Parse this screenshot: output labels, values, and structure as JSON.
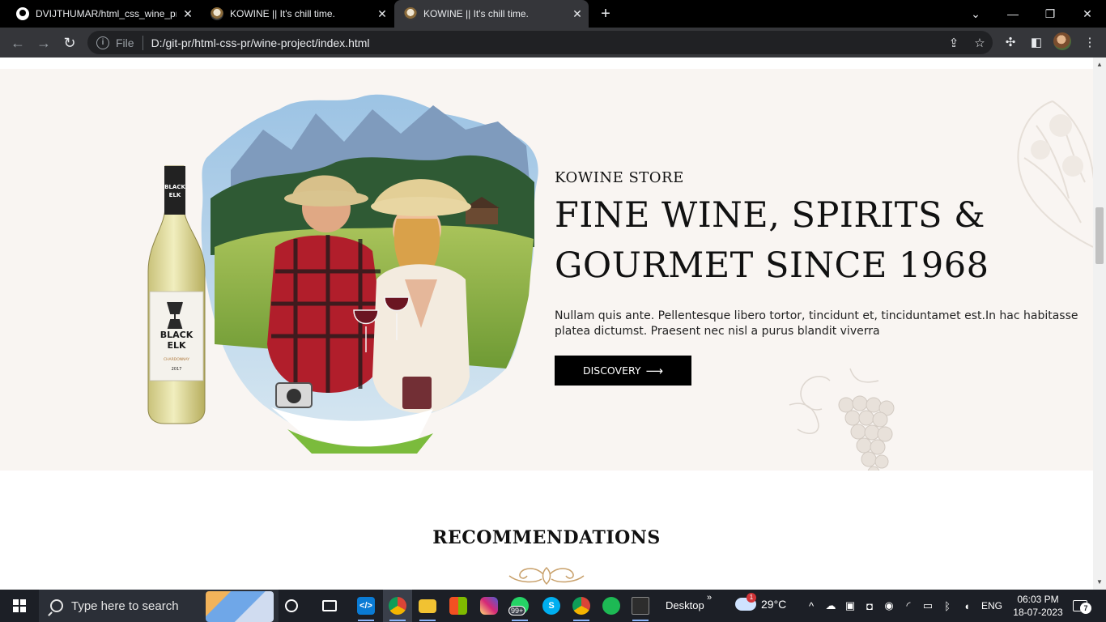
{
  "browser": {
    "tabs": [
      {
        "title": "DVIJTHUMAR/html_css_wine_pro",
        "active": false,
        "icon": "github-icon"
      },
      {
        "title": "KOWINE || It's chill time.",
        "active": false,
        "icon": "wine-site-icon"
      },
      {
        "title": "KOWINE || It's chill time.",
        "active": true,
        "icon": "wine-site-icon"
      }
    ],
    "new_tab": "+",
    "window_controls": {
      "tab_search": "⌄",
      "minimize": "—",
      "restore": "❐",
      "close": "✕"
    },
    "nav": {
      "back": "←",
      "forward": "→",
      "reload": "↻"
    },
    "address": {
      "info": "i",
      "scheme": "File",
      "url": "D:/git-pr/html-css-pr/wine-project/index.html"
    },
    "address_icons": {
      "share": "⇪",
      "bookmark": "☆"
    },
    "toolbar_icons": {
      "extensions": "✣",
      "side_panel": "◧",
      "menu": "⋮"
    }
  },
  "page": {
    "hero": {
      "store_label": "KOWINE STORE",
      "headline_line1": "FINE WINE, SPIRITS &",
      "headline_line2": "GOURMET SINCE 1968",
      "description": "Nullam quis ante. Pellentesque libero tortor, tincidunt et, tinciduntamet est.In hac habitasse platea dictumst. Praesent nec nisl a purus blandit viverra",
      "cta_label": "DISCOVERY",
      "cta_arrow": "⟶",
      "bottle_brand_line1": "BLACK",
      "bottle_brand_line2": "ELK",
      "bottle_variety": "CHARDONNAY",
      "bottle_year": "2017",
      "bottle_neck_line1": "BLACK",
      "bottle_neck_line2": "ELK"
    },
    "recommendations": {
      "title": "RECOMMENDATIONS"
    },
    "colors": {
      "hero_bg": "#f9f5f2",
      "text": "#111111",
      "button_bg": "#000000",
      "ornament": "#c8a06a"
    }
  },
  "scrollbar": {
    "up": "▲",
    "down": "▼"
  },
  "taskbar": {
    "search_placeholder": "Type here to search",
    "apps": [
      {
        "name": "cortana",
        "icon": "cortana-icon"
      },
      {
        "name": "task-view",
        "icon": "task-view-icon"
      },
      {
        "name": "vscode",
        "icon": "vscode-icon"
      },
      {
        "name": "chrome",
        "icon": "chrome-icon"
      },
      {
        "name": "file-explorer",
        "icon": "folder-icon"
      },
      {
        "name": "microsoft-store",
        "icon": "store-icon"
      },
      {
        "name": "instagram",
        "icon": "instagram-icon"
      },
      {
        "name": "whatsapp",
        "icon": "whatsapp-icon",
        "badge": "99+"
      },
      {
        "name": "skype",
        "icon": "skype-icon"
      },
      {
        "name": "chrome-profile",
        "icon": "chrome-icon"
      },
      {
        "name": "spotify",
        "icon": "spotify-icon"
      },
      {
        "name": "terminal",
        "icon": "terminal-icon"
      }
    ],
    "desktop_label": "Desktop",
    "desktop_chevron": "»",
    "weather": {
      "temp": "29°C",
      "badge": "1"
    },
    "tray": {
      "chevron": "^",
      "lang": "ENG"
    },
    "clock": {
      "time": "06:03 PM",
      "date": "18-07-2023"
    },
    "notifications": {
      "count": "7"
    }
  }
}
